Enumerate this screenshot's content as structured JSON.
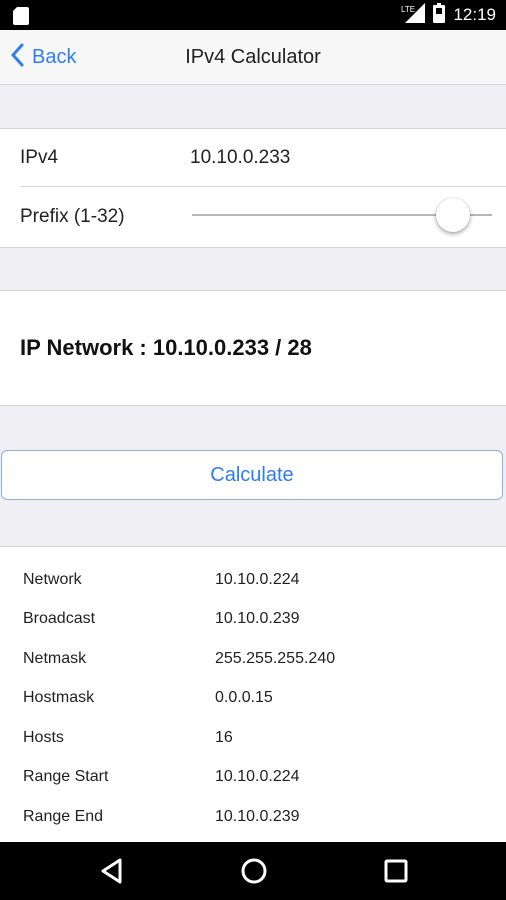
{
  "status_bar": {
    "time": "12:19",
    "network_label": "LTE",
    "icons": [
      "sd-card-icon",
      "lte-signal-icon",
      "battery-icon"
    ]
  },
  "nav": {
    "back_label": "Back",
    "title": "IPv4 Calculator",
    "accent_color": "#2f7cf6"
  },
  "inputs": {
    "ipv4_label": "IPv4",
    "ipv4_value": "10.10.0.233",
    "prefix_label": "Prefix (1-32)",
    "prefix_value": 28,
    "prefix_min": 1,
    "prefix_max": 32
  },
  "network": {
    "label": "IP Network : 10.10.0.233 / 28"
  },
  "calculate_label": "Calculate",
  "results": [
    {
      "label": "Network",
      "value": "10.10.0.224"
    },
    {
      "label": "Broadcast",
      "value": "10.10.0.239"
    },
    {
      "label": "Netmask",
      "value": "255.255.255.240"
    },
    {
      "label": "Hostmask",
      "value": "0.0.0.15"
    },
    {
      "label": "Hosts",
      "value": "16"
    },
    {
      "label": "Range Start",
      "value": "10.10.0.224"
    },
    {
      "label": "Range End",
      "value": "10.10.0.239"
    }
  ],
  "system_nav": {
    "icons": [
      "back-triangle-icon",
      "home-circle-icon",
      "recents-square-icon"
    ]
  }
}
